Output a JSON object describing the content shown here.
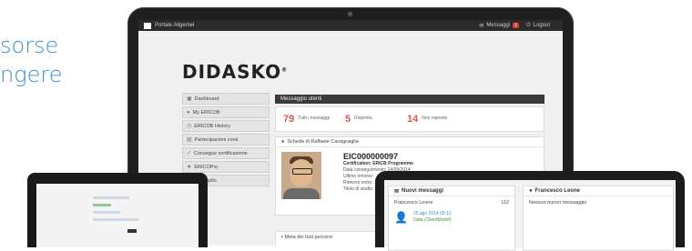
{
  "hero": {
    "line1": "sorse",
    "line2": "ngere"
  },
  "topbar": {
    "brand": "Portale Allgemei",
    "messages_label": "Messaggi",
    "messages_badge": "1",
    "logout_label": "Logout"
  },
  "logo": {
    "text": "DIDASKO",
    "mark": "®"
  },
  "sidebar": {
    "items": [
      {
        "label": "Dashboard",
        "icon": "dashboard-icon"
      },
      {
        "label": "My ERICOB",
        "icon": "user-icon"
      },
      {
        "label": "ERICOB History",
        "icon": "history-icon"
      },
      {
        "label": "Partecipazioni corsi",
        "icon": "course-icon"
      },
      {
        "label": "Consegue certificazione",
        "icon": "cert-icon"
      },
      {
        "label": "ERICOPro",
        "icon": "pro-icon"
      },
      {
        "label": "Aiuti di riepilo",
        "icon": ""
      }
    ]
  },
  "main": {
    "title": "Messaggio utenti",
    "stats": [
      {
        "value": "79",
        "label": "Tutti i messaggi"
      },
      {
        "value": "5",
        "label": "Risposta"
      },
      {
        "value": "14",
        "label": "Non risposte"
      }
    ],
    "profile_panel_title": "Scheda di Raffaele Cavagnaglia",
    "profile": {
      "code": "EIC000000097",
      "cert": "Certification: ERICB Programme",
      "lines": [
        "Data conseguimento: 14/09/2014",
        "Ultimo rinnovo:",
        "Rinnovo entro:",
        "Titolo di studio:"
      ]
    },
    "bottom_panel_title": "Meta dei tuoi percorsi"
  },
  "tablet": {
    "left_title": "Nuovi messaggi",
    "left_row_label": "Francesco Leone",
    "left_row_count": "112",
    "user_line1": "25 ago 2014 09:12",
    "user_line2": "Data (ClientModel)",
    "right_title": "Francesco Leone",
    "right_sub": "Nessun nuovo messaggio"
  }
}
